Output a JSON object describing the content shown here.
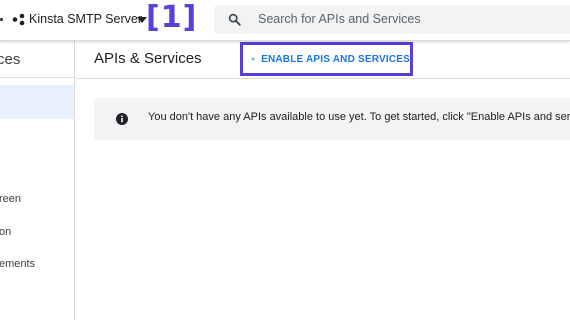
{
  "header": {
    "project_name": "Kinsta SMTP Server",
    "annotation_label": "[1]",
    "search": {
      "placeholder": "Search for APIs and Services",
      "value": ""
    }
  },
  "sidebar": {
    "header": "ces",
    "items": [
      {
        "label": "reen"
      },
      {
        "label": "on"
      },
      {
        "label": "ements"
      }
    ]
  },
  "main": {
    "title": "APIs & Services",
    "enable_button_label": "ENABLE APIS AND SERVICES",
    "info_message": "You don't have any APIs available to use yet. To get started, click \"Enable APIs and services\""
  },
  "colors": {
    "accent": "#1a73e8",
    "annotation": "#5b3fd9",
    "active_item_bg": "#e8f0fe",
    "banner_bg": "#f1f3f4"
  },
  "icons": [
    "project-icon",
    "chevron-down-icon",
    "search-icon",
    "plus-icon",
    "info-icon"
  ]
}
